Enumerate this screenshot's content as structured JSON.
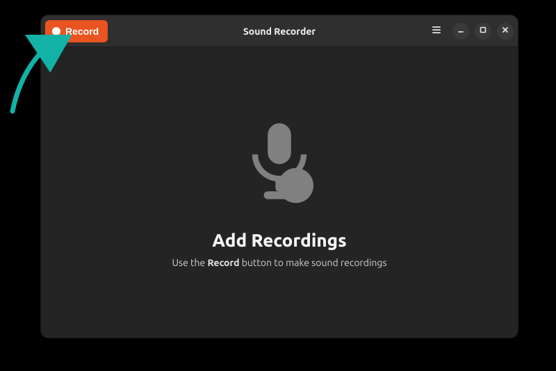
{
  "header": {
    "title": "Sound Recorder",
    "record_label": "Record"
  },
  "empty_state": {
    "heading": "Add Recordings",
    "sub_pre": "Use the ",
    "sub_bold": "Record",
    "sub_post": " button to make sound recordings"
  },
  "colors": {
    "accent": "#e95420",
    "arrow": "#12b2a7"
  }
}
